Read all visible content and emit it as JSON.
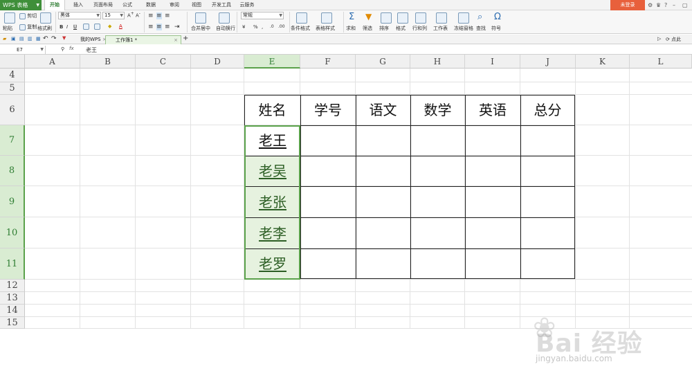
{
  "app": {
    "logo": "WPS 表格",
    "login": "未登录"
  },
  "menu": [
    "开始",
    "插入",
    "页面布局",
    "公式",
    "数据",
    "审阅",
    "视图",
    "开发工具",
    "云服务"
  ],
  "window_controls": [
    "⚙",
    "♛",
    "?",
    "–",
    "▢"
  ],
  "ribbon": {
    "paste": "粘贴",
    "cut": "剪切",
    "copy": "复制",
    "format_painter": "格式刷",
    "font_name": "黑体",
    "font_size": "15",
    "bold": "B",
    "italic": "I",
    "underline": "U",
    "merge": "合并居中",
    "wrap": "自动换行",
    "number_format": "常规",
    "currency": "¥",
    "percent": "%",
    "cond_format": "条件格式",
    "table_style": "表格样式",
    "sum": "求和",
    "filter": "筛选",
    "sort": "排序",
    "format": "格式",
    "rows_cols": "行和列",
    "worksheet": "工作表",
    "freeze": "冻结窗格",
    "find": "查找",
    "symbol": "符号"
  },
  "doc_tabs": {
    "mywps": "我的WPS",
    "book": "工作簿1 *"
  },
  "qat_right": "点此",
  "formula_bar": {
    "cell_ref": "E7",
    "fx": "fx",
    "content": "老王"
  },
  "columns": [
    "A",
    "B",
    "C",
    "D",
    "E",
    "F",
    "G",
    "H",
    "I",
    "J",
    "K",
    "L"
  ],
  "rows": [
    "4",
    "5",
    "6",
    "7",
    "8",
    "9",
    "10",
    "11",
    "12",
    "13",
    "14",
    "15"
  ],
  "table": {
    "headers": [
      "姓名",
      "学号",
      "语文",
      "数学",
      "英语",
      "总分"
    ],
    "names": [
      "老王",
      "老吴",
      "老张",
      "老李",
      "老罗"
    ]
  },
  "watermark": {
    "text": "Bai 经验",
    "url": "jingyan.baidu.com"
  },
  "colors": {
    "accent": "#3f8f3a",
    "selection": "#5aa14a",
    "login": "#e8603c"
  }
}
